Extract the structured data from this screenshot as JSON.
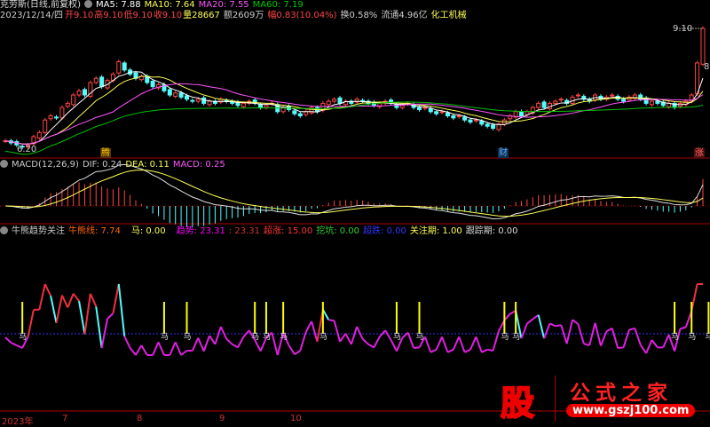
{
  "header": {
    "stock": "克劳斯(日线,前复权)",
    "ma5": "MA5: 7.88",
    "ma10": "MA10: 7.64",
    "ma20": "MA20: 7.55",
    "ma60": "MA60: 7.19",
    "date": "2023/12/14/四",
    "open": "开9.10",
    "high": "高9.10",
    "low": "低9.10",
    "close": "收9.10",
    "vol": "量28667",
    "amount": "额2609万",
    "change": "幅0.83(10.04%)",
    "turnover": "换0.58%",
    "float": "流通4.96亿",
    "sector": "化工机械"
  },
  "price_labels": {
    "max": "9.10",
    "min": "6.20",
    "last": "8."
  },
  "markers": {
    "m1": "腾",
    "m2": "财",
    "m3": "涨"
  },
  "macd": {
    "title": "MACD(12,26,9)",
    "dif": "DIF: 0.24",
    "dea": "DEA: 0.11",
    "macd": "MACD: 0.25"
  },
  "indicator": {
    "title": "牛熊趋势关注",
    "bull": "牛熊线: 7.74",
    "ma": "马: 0.00",
    "trend": "趋势: 23.31",
    "trend2": ": 23.31",
    "surge": "超涨: 15.00",
    "dig": "挖坑: 0.00",
    "drop": "超跌: 0.00",
    "watch": "关注期: 1.00",
    "track": "跟踪期: 0.00",
    "mark_char": "马"
  },
  "axis": {
    "labels": [
      "2023年",
      "7",
      "8",
      "9",
      "10"
    ]
  },
  "logo": {
    "char": "股",
    "name": "公式之家",
    "url": "www.gszj100.com"
  },
  "colors": {
    "up": "#ff4444",
    "down": "#54fcfc",
    "ma5": "#ffffff",
    "ma10": "#ffff54",
    "ma20": "#ff54ff",
    "ma60": "#00c000"
  },
  "chart_data": {
    "type": "candlestick",
    "price_range": [
      6.2,
      9.1
    ],
    "closes": [
      6.4,
      6.35,
      6.3,
      6.25,
      6.3,
      6.5,
      6.6,
      6.9,
      7.0,
      6.95,
      7.2,
      7.3,
      7.5,
      7.6,
      7.5,
      7.8,
      7.9,
      7.7,
      7.85,
      8.0,
      8.3,
      8.1,
      8.0,
      7.9,
      7.95,
      7.8,
      7.7,
      7.75,
      7.6,
      7.5,
      7.55,
      7.45,
      7.4,
      7.35,
      7.4,
      7.3,
      7.35,
      7.3,
      7.4,
      7.35,
      7.3,
      7.25,
      7.3,
      7.35,
      7.3,
      7.2,
      7.25,
      7.3,
      7.1,
      7.2,
      7.15,
      7.05,
      7.0,
      7.1,
      7.2,
      7.1,
      7.3,
      7.35,
      7.4,
      7.3,
      7.35,
      7.3,
      7.4,
      7.35,
      7.3,
      7.25,
      7.3,
      7.35,
      7.3,
      7.2,
      7.25,
      7.3,
      7.2,
      7.15,
      7.2,
      7.1,
      7.05,
      7.1,
      7.0,
      6.95,
      7.0,
      6.9,
      6.85,
      6.9,
      6.8,
      6.75,
      6.7,
      6.8,
      6.9,
      7.0,
      7.1,
      7.0,
      7.1,
      7.2,
      7.3,
      7.2,
      7.3,
      7.35,
      7.4,
      7.3,
      7.45,
      7.5,
      7.4,
      7.35,
      7.5,
      7.4,
      7.45,
      7.5,
      7.4,
      7.35,
      7.45,
      7.5,
      7.4,
      7.3,
      7.35,
      7.3,
      7.25,
      7.3,
      7.2,
      7.3,
      7.35,
      7.5,
      8.27,
      9.1
    ],
    "signal_bars": [
      3,
      28,
      32,
      44,
      46,
      49,
      56,
      69,
      73,
      88,
      90,
      118,
      121,
      124
    ]
  }
}
